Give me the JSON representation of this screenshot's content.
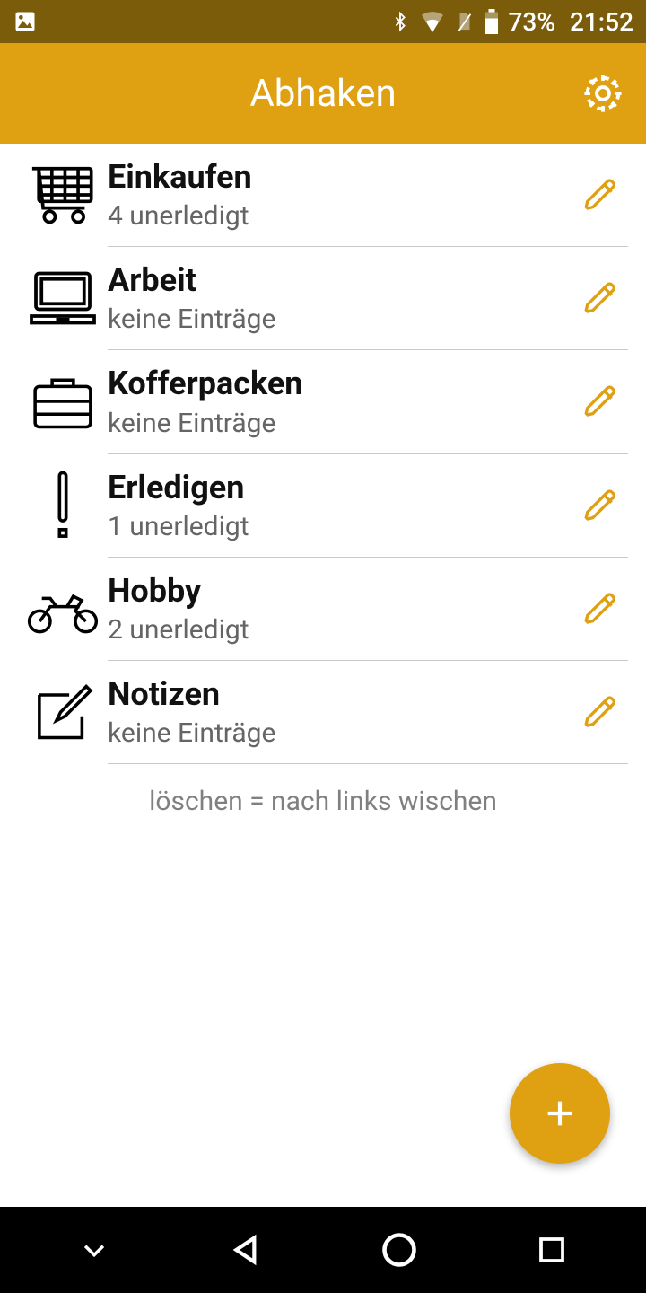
{
  "status": {
    "battery": "73%",
    "time": "21:52"
  },
  "app": {
    "title": "Abhaken"
  },
  "lists": [
    {
      "icon": "cart",
      "title": "Einkaufen",
      "subtitle": "4 unerledigt"
    },
    {
      "icon": "laptop",
      "title": "Arbeit",
      "subtitle": "keine Einträge"
    },
    {
      "icon": "suitcase",
      "title": "Kofferpacken",
      "subtitle": "keine Einträge"
    },
    {
      "icon": "exclaim",
      "title": "Erledigen",
      "subtitle": "1 unerledigt"
    },
    {
      "icon": "moto",
      "title": "Hobby",
      "subtitle": "2 unerledigt"
    },
    {
      "icon": "note",
      "title": "Notizen",
      "subtitle": "keine Einträge"
    }
  ],
  "hint": "löschen = nach links wischen",
  "colors": {
    "accent": "#dfa011",
    "statusbar": "#7a5c0a"
  }
}
